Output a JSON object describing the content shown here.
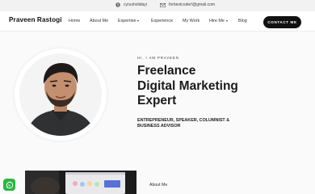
{
  "topbar": {
    "skype": "cyrusholidayi",
    "email": "forbestcoder!@gmail.com"
  },
  "navbar": {
    "brand": "Praveen Rastogi",
    "items": [
      {
        "label": "Home"
      },
      {
        "label": "About Me"
      },
      {
        "label": "Expertise"
      },
      {
        "label": "Experience"
      },
      {
        "label": "My Work"
      },
      {
        "label": "Hire Me"
      },
      {
        "label": "Blog"
      }
    ],
    "cta": "CONTACT ME"
  },
  "hero": {
    "eyebrow": "HI, I AM PRAVEEN",
    "headline": [
      "Freelance",
      "Digital Marketing",
      "Expert"
    ],
    "subtitle": "ENTREPRENEUR, SPEAKER, COLUMNIST & BUSINESS ADVISOR"
  },
  "about": {
    "label": "About Me"
  },
  "colors": {
    "accent": "#111111",
    "whatsapp": "#2bb741"
  }
}
